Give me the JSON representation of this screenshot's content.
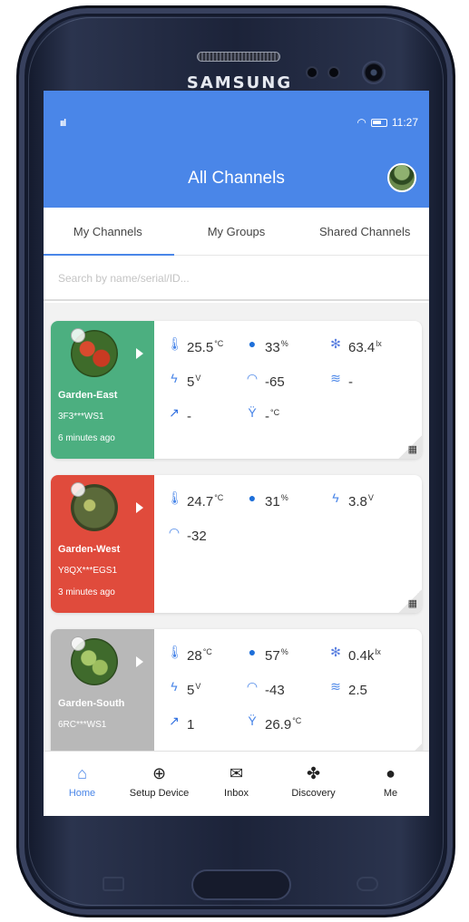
{
  "device": {
    "brand": "SAMSUNG"
  },
  "status_bar": {
    "time": "11:27",
    "signal": "ııl"
  },
  "header": {
    "title": "All Channels"
  },
  "tabs": [
    {
      "label": "My Channels",
      "active": true
    },
    {
      "label": "My Groups",
      "active": false
    },
    {
      "label": "Shared Channels",
      "active": false
    }
  ],
  "search": {
    "placeholder": "Search by name/serial/ID..."
  },
  "channels": [
    {
      "name": "Garden-East",
      "serial": "3F3***WS1",
      "updated": "6 minutes ago",
      "color": "#4caf80",
      "readings": [
        {
          "icon": "thermometer-icon",
          "value": "25.5",
          "unit": "°C"
        },
        {
          "icon": "humidity-drop-icon",
          "value": "33",
          "unit": "%"
        },
        {
          "icon": "snowflake-icon",
          "value": "63.4",
          "unit": "lx"
        },
        {
          "icon": "voltage-bolt-icon",
          "value": "5",
          "unit": "V"
        },
        {
          "icon": "wifi-icon",
          "value": "-65",
          "unit": ""
        },
        {
          "icon": "wind-icon",
          "value": "-",
          "unit": ""
        },
        {
          "icon": "axe-icon",
          "value": "-",
          "unit": ""
        },
        {
          "icon": "tree-icon",
          "value": "-",
          "unit": "°C"
        }
      ]
    },
    {
      "name": "Garden-West",
      "serial": "Y8QX***EGS1",
      "updated": "3 minutes ago",
      "color": "#e04b3c",
      "readings": [
        {
          "icon": "thermometer-icon",
          "value": "24.7",
          "unit": "°C"
        },
        {
          "icon": "humidity-drop-icon",
          "value": "31",
          "unit": "%"
        },
        {
          "icon": "voltage-bolt-icon",
          "value": "3.8",
          "unit": "V"
        },
        {
          "icon": "wifi-icon",
          "value": "-32",
          "unit": ""
        }
      ]
    },
    {
      "name": "Garden-South",
      "serial": "6RC***WS1",
      "updated": "",
      "color": "#b8b8b8",
      "readings": [
        {
          "icon": "thermometer-icon",
          "value": "28",
          "unit": "°C"
        },
        {
          "icon": "humidity-drop-icon",
          "value": "57",
          "unit": "%"
        },
        {
          "icon": "snowflake-icon",
          "value": "0.4k",
          "unit": "lx"
        },
        {
          "icon": "voltage-bolt-icon",
          "value": "5",
          "unit": "V"
        },
        {
          "icon": "wifi-icon",
          "value": "-43",
          "unit": ""
        },
        {
          "icon": "wind-icon",
          "value": "2.5",
          "unit": ""
        },
        {
          "icon": "axe-icon",
          "value": "1",
          "unit": ""
        },
        {
          "icon": "tree-icon",
          "value": "26.9",
          "unit": "°C"
        }
      ]
    }
  ],
  "bottom_nav": [
    {
      "label": "Home",
      "icon": "home-icon",
      "active": true
    },
    {
      "label": "Setup Device",
      "icon": "plus-circle-icon",
      "active": false
    },
    {
      "label": "Inbox",
      "icon": "envelope-icon",
      "active": false
    },
    {
      "label": "Discovery",
      "icon": "fan-icon",
      "active": false
    },
    {
      "label": "Me",
      "icon": "person-icon",
      "active": false
    }
  ]
}
